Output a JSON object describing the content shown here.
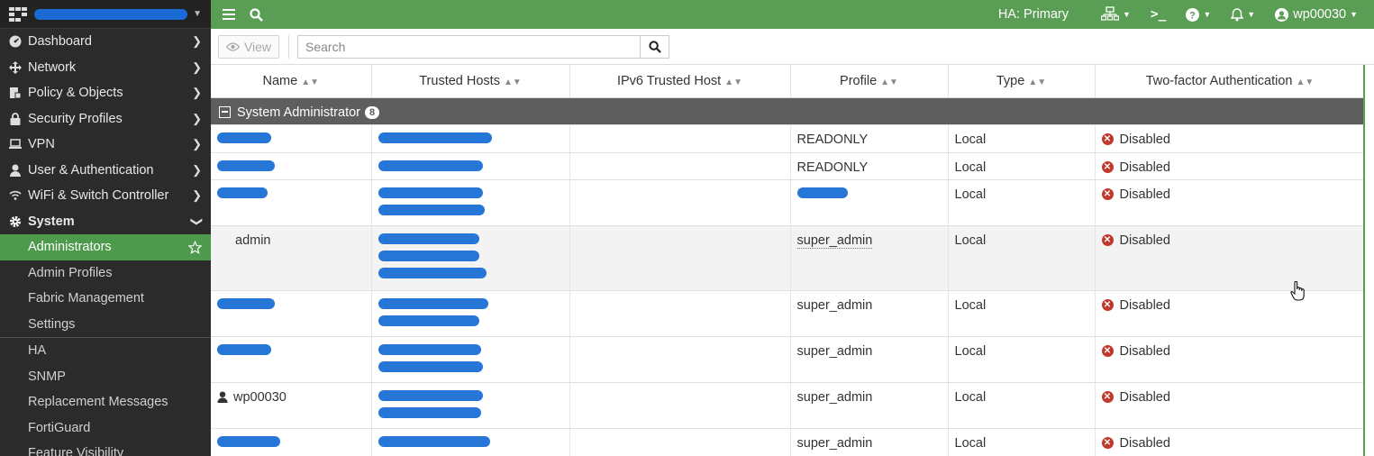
{
  "sidebar": {
    "items": [
      {
        "label": "Dashboard",
        "icon": "dashboard-icon"
      },
      {
        "label": "Network",
        "icon": "network-icon"
      },
      {
        "label": "Policy & Objects",
        "icon": "policy-icon"
      },
      {
        "label": "Security Profiles",
        "icon": "lock-icon"
      },
      {
        "label": "VPN",
        "icon": "laptop-icon"
      },
      {
        "label": "User & Authentication",
        "icon": "user-icon"
      },
      {
        "label": "WiFi & Switch Controller",
        "icon": "wifi-icon"
      },
      {
        "label": "System",
        "icon": "gear-icon"
      }
    ],
    "system_subitems": [
      "Administrators",
      "Admin Profiles",
      "Fabric Management",
      "Settings"
    ],
    "system_more": [
      "HA",
      "SNMP",
      "Replacement Messages",
      "FortiGuard",
      "Feature Visibility"
    ]
  },
  "topbar": {
    "ha_status": "HA: Primary",
    "user": "wp00030"
  },
  "toolbar": {
    "view_label": "View",
    "search_placeholder": "Search"
  },
  "table": {
    "columns": [
      "Name",
      "Trusted Hosts",
      "IPv6 Trusted Host",
      "Profile",
      "Type",
      "Two-factor Authentication"
    ],
    "group": {
      "label": "System Administrator",
      "count": "8"
    },
    "rows": [
      {
        "name": "",
        "profile": "READONLY",
        "type": "Local",
        "tfa": "Disabled"
      },
      {
        "name": "",
        "profile": "READONLY",
        "type": "Local",
        "tfa": "Disabled"
      },
      {
        "name": "",
        "profile": "",
        "type": "Local",
        "tfa": "Disabled"
      },
      {
        "name": "admin",
        "profile": "super_admin",
        "type": "Local",
        "tfa": "Disabled"
      },
      {
        "name": "",
        "profile": "super_admin",
        "type": "Local",
        "tfa": "Disabled"
      },
      {
        "name": "",
        "profile": "super_admin",
        "type": "Local",
        "tfa": "Disabled"
      },
      {
        "name": "wp00030",
        "profile": "super_admin",
        "type": "Local",
        "tfa": "Disabled"
      },
      {
        "name": "",
        "profile": "super_admin",
        "type": "Local",
        "tfa": "Disabled"
      }
    ]
  },
  "colors": {
    "accent": "#5a9d55",
    "sidebar_bg": "#2b2b2b",
    "group_bg": "#5e5e5e",
    "disabled": "#c0392b"
  }
}
